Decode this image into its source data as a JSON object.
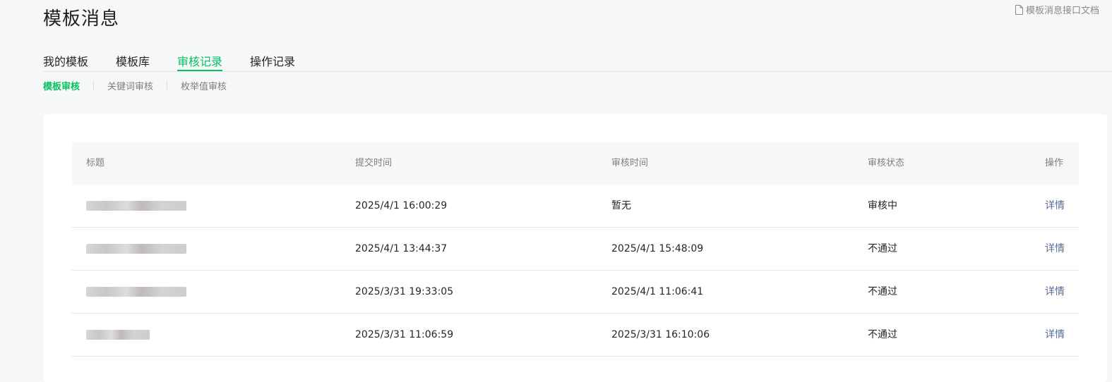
{
  "page": {
    "title": "模板消息",
    "doc_link_label": "模板消息接口文档"
  },
  "tabs": [
    {
      "label": "我的模板",
      "active": false
    },
    {
      "label": "模板库",
      "active": false
    },
    {
      "label": "审核记录",
      "active": true
    },
    {
      "label": "操作记录",
      "active": false
    }
  ],
  "subtabs": [
    {
      "label": "模板审核",
      "active": true
    },
    {
      "label": "关键词审核",
      "active": false
    },
    {
      "label": "枚举值审核",
      "active": false
    }
  ],
  "table": {
    "headers": {
      "title": "标题",
      "submit_time": "提交时间",
      "review_time": "审核时间",
      "status": "审核状态",
      "action": "操作"
    },
    "rows": [
      {
        "submit_time": "2025/4/1 16:00:29",
        "review_time": "暂无",
        "status": "审核中",
        "action": "详情"
      },
      {
        "submit_time": "2025/4/1 13:44:37",
        "review_time": "2025/4/1 15:48:09",
        "status": "不通过",
        "action": "详情"
      },
      {
        "submit_time": "2025/3/31 19:33:05",
        "review_time": "2025/4/1 11:06:41",
        "status": "不通过",
        "action": "详情"
      },
      {
        "submit_time": "2025/3/31 11:06:59",
        "review_time": "2025/3/31 16:10:06",
        "status": "不通过",
        "action": "详情"
      }
    ]
  },
  "colors": {
    "accent": "#07c160",
    "link": "#576b95",
    "background": "#f6f7f9"
  },
  "icons": {
    "doc_link": "document-icon"
  }
}
